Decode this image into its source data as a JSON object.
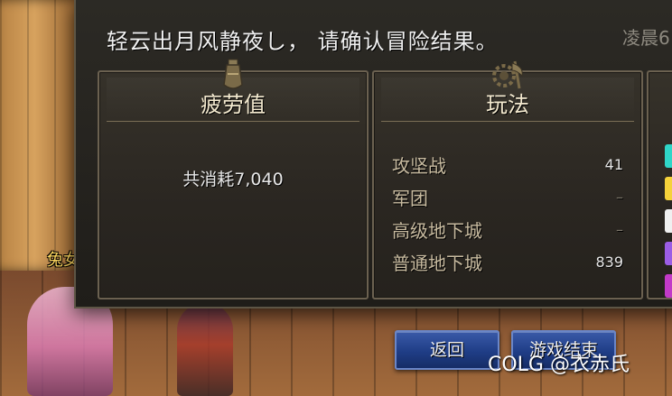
{
  "dialog": {
    "title": "轻云出月风静夜し，  请确认冒险结果。",
    "time": "凌晨6"
  },
  "fatigue": {
    "heading": "疲劳值",
    "total": "共消耗7,040"
  },
  "play": {
    "heading": "玩法",
    "rows": [
      {
        "name": "攻坚战",
        "value": "41"
      },
      {
        "name": "军团",
        "value": "–"
      },
      {
        "name": "高级地下城",
        "value": "–"
      },
      {
        "name": "普通地下城",
        "value": "839"
      }
    ]
  },
  "extra_panel": {
    "marks": [
      "#2fd6c8",
      "#f5d23a",
      "#f0f0f0",
      "#9b5de5",
      "#c23ac8"
    ]
  },
  "buttons": {
    "back": "返回",
    "end": "游戏结束"
  },
  "scene": {
    "character_name": "兔女"
  },
  "watermark": "COLG @衣赤氏",
  "colors": {
    "button_blue": "#1f3d86",
    "panel_border": "#6b6150",
    "heading_text": "#f3e9cf"
  }
}
